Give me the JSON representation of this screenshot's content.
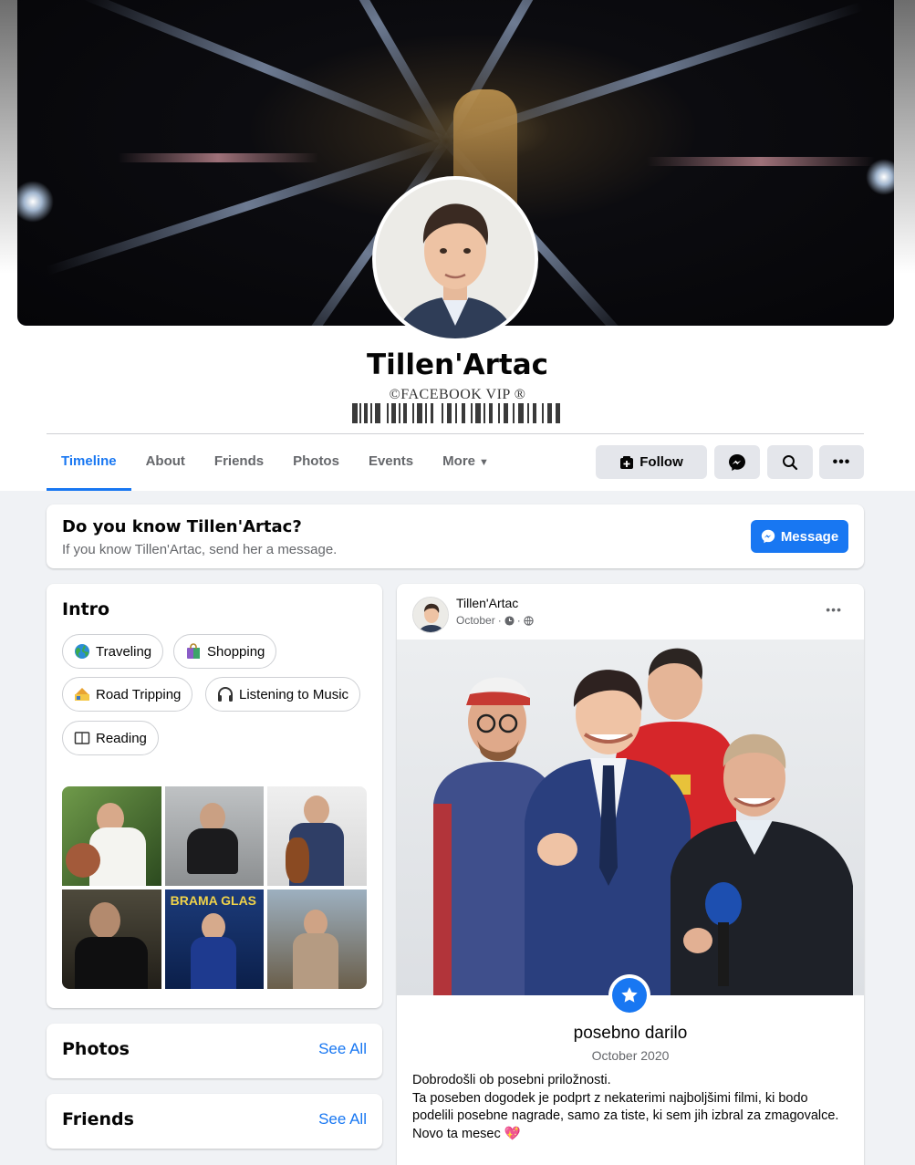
{
  "profile": {
    "name": "Tillen'Artac",
    "subtitle": "©FACEBOOK VIP ®"
  },
  "tabs": [
    {
      "label": "Timeline",
      "active": true
    },
    {
      "label": "About"
    },
    {
      "label": "Friends"
    },
    {
      "label": "Photos"
    },
    {
      "label": "Events"
    },
    {
      "label": "More"
    }
  ],
  "actions": {
    "follow_label": "Follow",
    "messenger_icon": "messenger-icon",
    "search_icon": "search-icon",
    "more_icon": "more-dots-icon"
  },
  "know_card": {
    "title": "Do you know Tillen'Artac?",
    "subtitle": "If you know Tillen'Artac, send her a message.",
    "button_label": "Message"
  },
  "intro": {
    "title": "Intro",
    "hobbies": [
      {
        "label": "Traveling",
        "icon": "globe-icon"
      },
      {
        "label": "Shopping",
        "icon": "shopping-bag-icon"
      },
      {
        "label": "Road Tripping",
        "icon": "road-trip-icon"
      },
      {
        "label": "Listening to Music",
        "icon": "headphones-icon"
      },
      {
        "label": "Reading",
        "icon": "book-icon"
      }
    ]
  },
  "photos_card": {
    "title": "Photos",
    "see_all": "See All"
  },
  "friends_card": {
    "title": "Friends",
    "see_all": "See All"
  },
  "post": {
    "author": "Tillen'Artac",
    "date": "October",
    "event_title": "posebno darilo",
    "event_date": "October 2020",
    "body": [
      "Dobrodošli ob posebni priložnosti.",
      "Ta poseben dogodek je podprt z nekaterimi najboljšimi filmi, ki bodo podelili posebne nagrade, samo za tiste, ki sem jih izbral za zmagovalce.",
      "Novo ta mesec 💖"
    ]
  },
  "colors": {
    "accent": "#1877f2",
    "background": "#f0f2f5",
    "secondary_text": "#65676b"
  }
}
